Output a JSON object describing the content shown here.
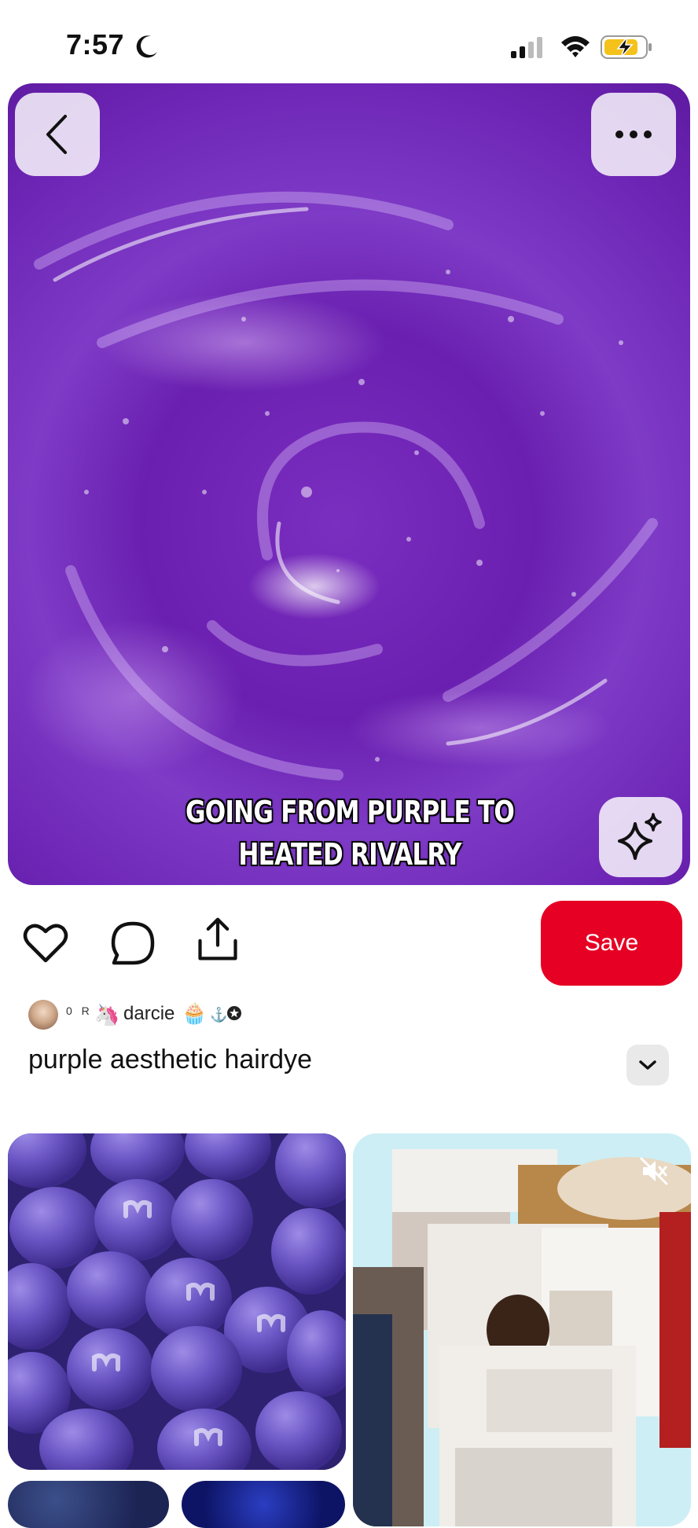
{
  "status_bar": {
    "time": "7:57",
    "icons": [
      "moon-icon",
      "cellular-signal-icon",
      "wifi-icon",
      "battery-charging-icon"
    ]
  },
  "pin": {
    "caption": "GOING FROM PURPLE TO HEATED RIVALRY",
    "title": "purple aesthetic hairdye",
    "save_label": "Save",
    "creator": {
      "follower_count": "0 R",
      "name": "darcie"
    }
  },
  "colors": {
    "save_button": "#e60023",
    "hero_purple": "#6d25b5"
  },
  "related_pins": [
    {
      "name": "purple-candy-pin"
    },
    {
      "name": "room-video-pin"
    },
    {
      "name": "galaxy-pin-1"
    },
    {
      "name": "galaxy-pin-2"
    }
  ]
}
